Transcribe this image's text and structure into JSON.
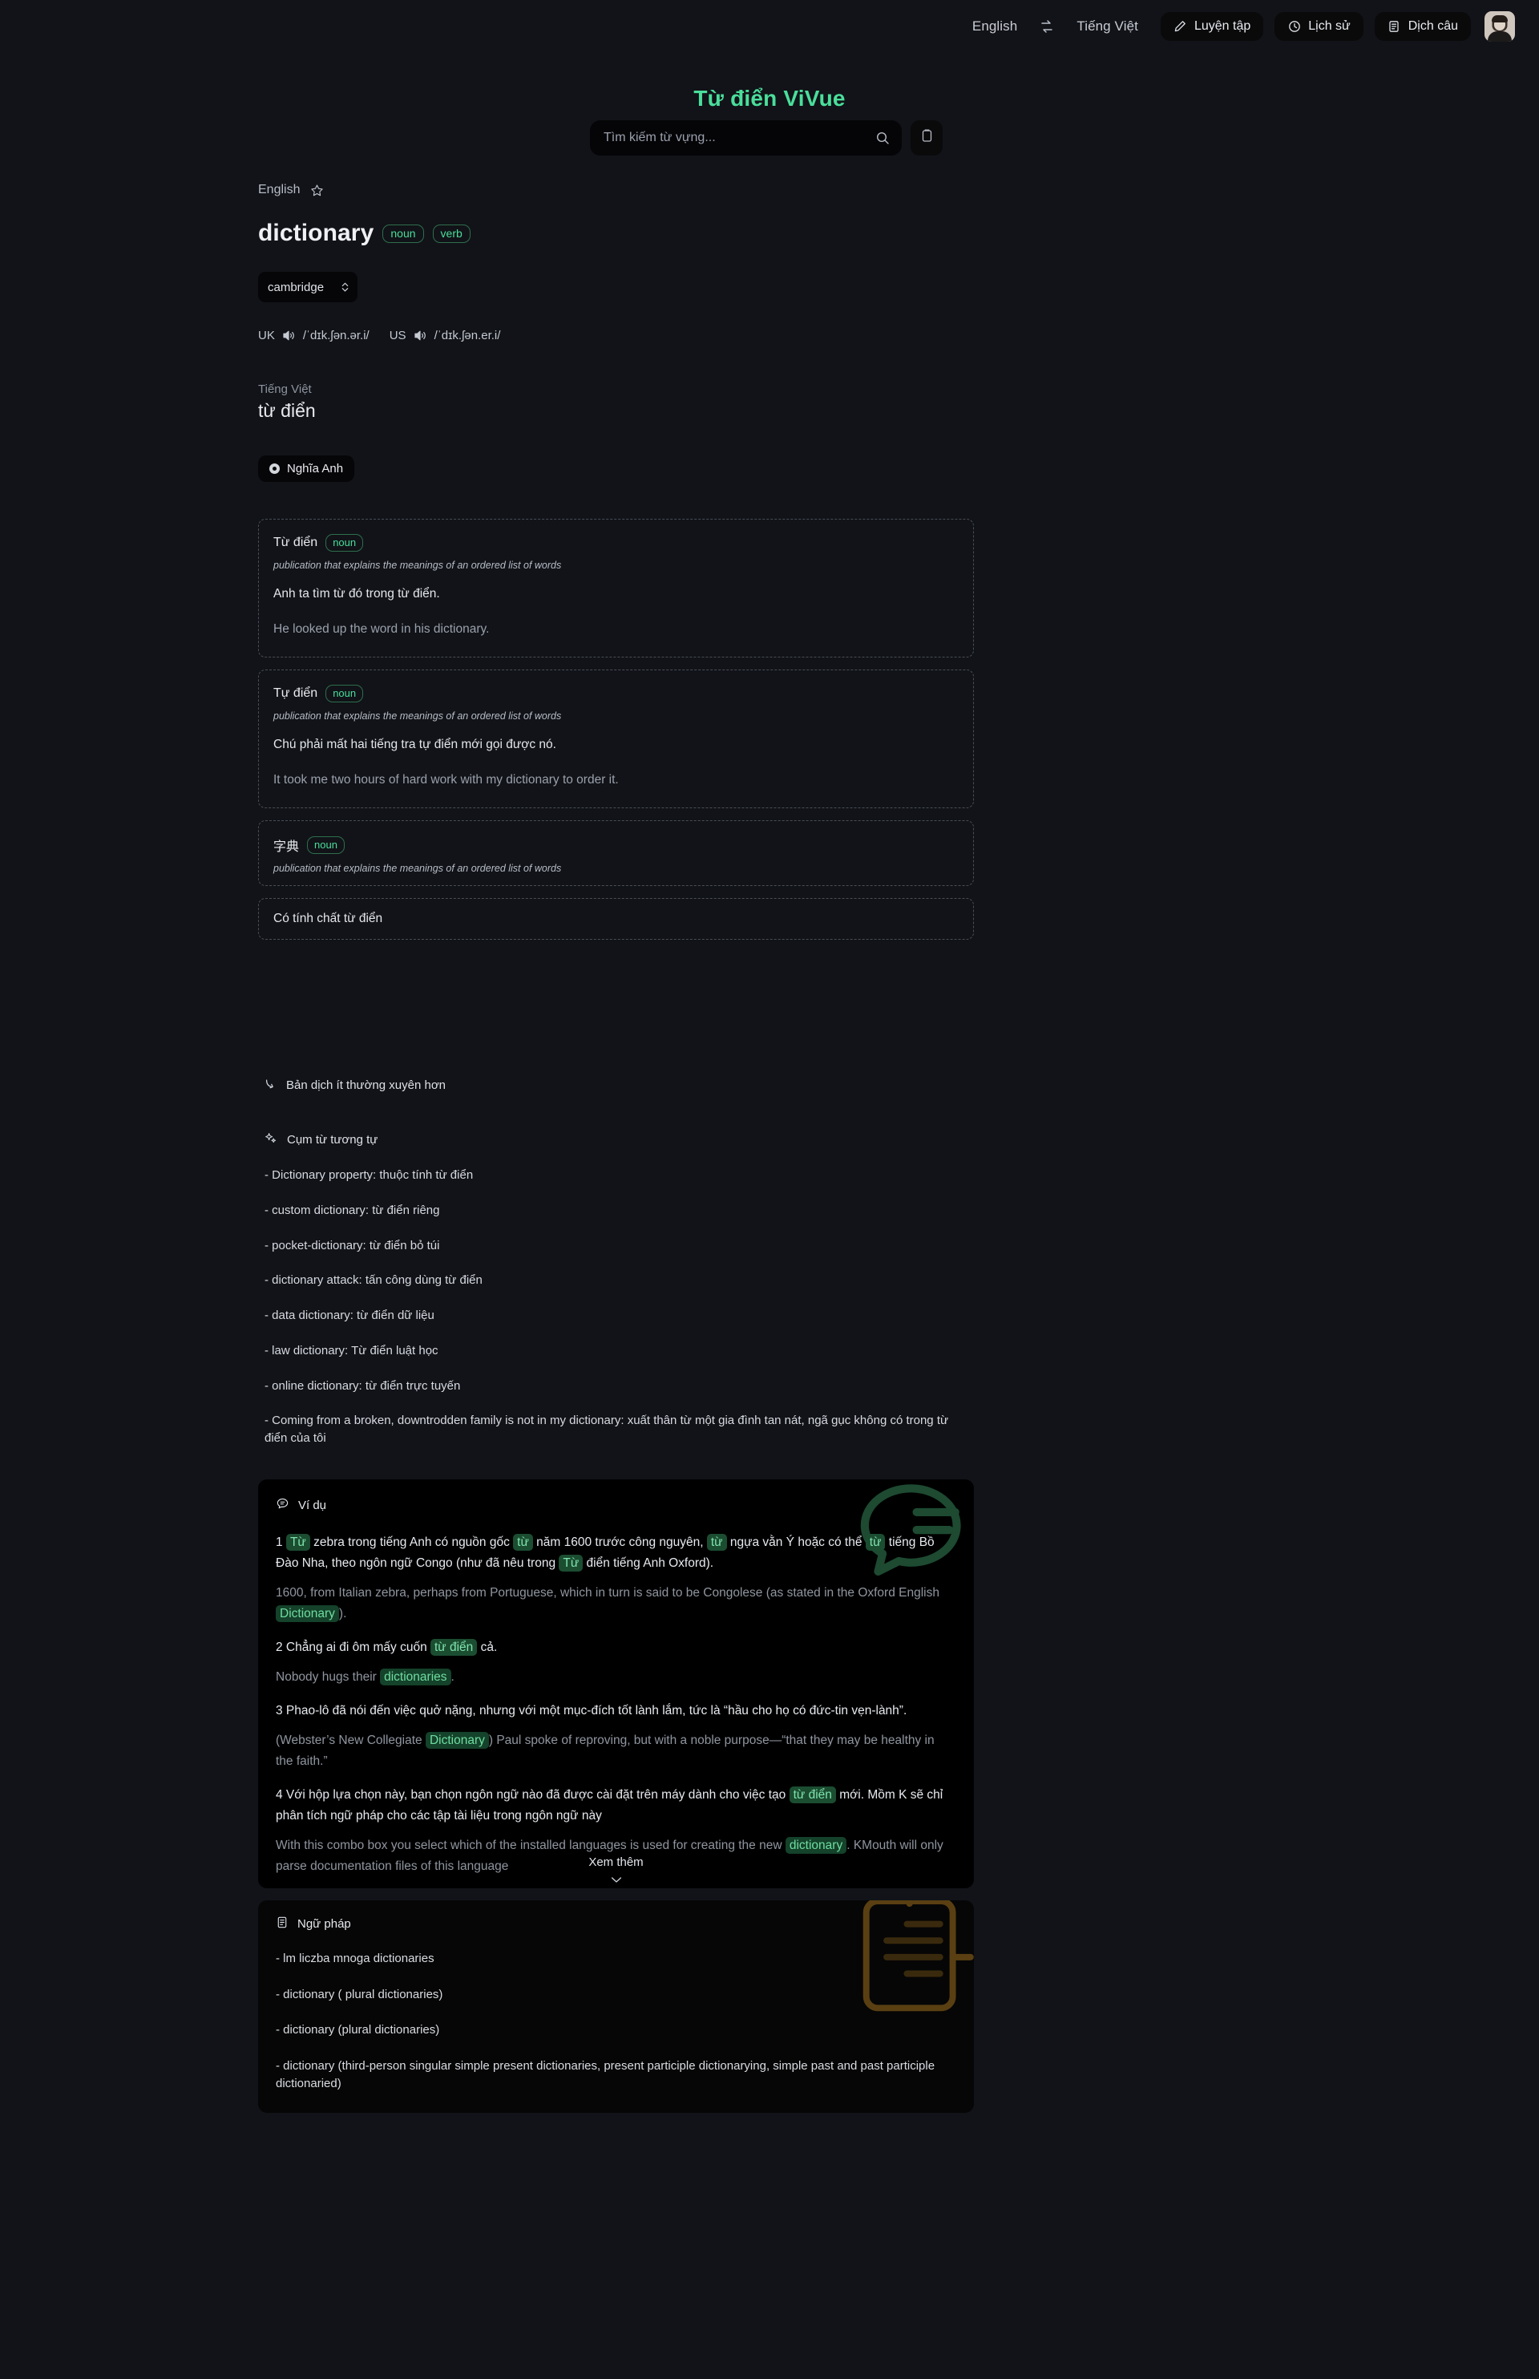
{
  "topbar": {
    "source_language": "English",
    "swap_icon": "swap-arrows-icon",
    "target_language": "Tiếng Việt",
    "buttons": [
      {
        "label": "Luyện tập",
        "icon": "pencil-icon"
      },
      {
        "label": "Lịch sử",
        "icon": "clock-icon"
      },
      {
        "label": "Dịch câu",
        "icon": "document-icon"
      }
    ],
    "avatar": "user-avatar"
  },
  "brand": {
    "title": "Từ điển ViVue"
  },
  "search": {
    "placeholder": "Tìm kiếm từ vựng...",
    "value": "",
    "search_icon": "search-icon",
    "clipboard_icon": "clipboard-icon"
  },
  "entry": {
    "source_language": "English",
    "star_icon": "star-outline-icon",
    "headword": "dictionary",
    "pos_tags": [
      "noun",
      "verb"
    ],
    "dictionary_source": "cambridge",
    "dictionary_options": [
      "cambridge"
    ],
    "pronunciations": [
      {
        "region": "UK",
        "speaker_icon": "speaker-icon",
        "ipa": "/ˈdɪk.ʃən.ər.i/"
      },
      {
        "region": "US",
        "speaker_icon": "speaker-icon",
        "ipa": "/ˈdɪk.ʃən.er.i/"
      }
    ],
    "target_language": "Tiếng Việt",
    "target_word": "từ điển",
    "english_meaning_button": "Nghĩa Anh"
  },
  "definitions": [
    {
      "term": "Từ điển",
      "tag": "noun",
      "gloss": "publication that explains the meanings of an ordered list of words",
      "example_vi": "Anh ta tìm từ đó trong từ điển.",
      "example_en": "He looked up the word in his dictionary."
    },
    {
      "term": "Tự điển",
      "tag": "noun",
      "gloss": "publication that explains the meanings of an ordered list of words",
      "example_vi": "Chú phải mất hai tiếng tra tự điển mới gọi được nó.",
      "example_en": "It took me two hours of hard work with my dictionary to order it."
    },
    {
      "term": "字典",
      "tag": "noun",
      "gloss": "publication that explains the meanings of an ordered list of words",
      "example_vi": "",
      "example_en": ""
    }
  ],
  "extra_definition": "Có tính chất từ điển",
  "less_frequent": {
    "label": "Bản dịch ít thường xuyên hơn",
    "icon": "arrow-curve-down-icon"
  },
  "phrases_section": {
    "title": "Cụm từ tương tự",
    "icon": "sparkle-icon",
    "items": [
      "- Dictionary property: thuộc tính từ điển",
      "- custom dictionary: từ điển riêng",
      "- pocket-dictionary: từ điển bỏ túi",
      "- dictionary attack: tấn công dùng từ điển",
      "- data dictionary: từ điển dữ liệu",
      "- law dictionary: Từ điển luật học",
      "- online dictionary: từ điển trực tuyến",
      "- Coming from a broken, downtrodden family is not in my dictionary: xuất thân từ một gia đình tan nát, ngã gục không có trong từ điển của tôi"
    ]
  },
  "examples_section": {
    "title": "Ví dụ",
    "icon": "quote-bubble-icon",
    "background_icon": "quote-bubble-watermark",
    "items": [
      {
        "number": "1",
        "vi_parts": [
          {
            "t": "1 ",
            "h": false
          },
          {
            "t": "Từ",
            "h": true
          },
          {
            "t": " zebra trong tiếng Anh có nguồn gốc ",
            "h": false
          },
          {
            "t": "từ",
            "h": true
          },
          {
            "t": " năm 1600 trước công nguyên, ",
            "h": false
          },
          {
            "t": "từ",
            "h": true
          },
          {
            "t": " ngựa vằn Ý hoặc có thể ",
            "h": false
          },
          {
            "t": "từ",
            "h": true
          },
          {
            "t": " tiếng Bồ Đào Nha, theo ngôn ngữ Congo (như đã nêu trong ",
            "h": false
          },
          {
            "t": "Từ",
            "h": true
          },
          {
            "t": " điển tiếng Anh Oxford).",
            "h": false
          }
        ],
        "en_parts": [
          {
            "t": "1600, from Italian zebra, perhaps from Portuguese, which in turn is said to be Congolese (as stated in the Oxford English ",
            "h": false
          },
          {
            "t": "Dictionary",
            "h": true
          },
          {
            "t": ").",
            "h": false
          }
        ]
      },
      {
        "number": "2",
        "vi_parts": [
          {
            "t": "2 Chẳng ai đi ôm mấy cuốn ",
            "h": false
          },
          {
            "t": "từ điển",
            "h": true
          },
          {
            "t": " cả.",
            "h": false
          }
        ],
        "en_parts": [
          {
            "t": "Nobody hugs their ",
            "h": false
          },
          {
            "t": "dictionaries",
            "h": true
          },
          {
            "t": ".",
            "h": false
          }
        ]
      },
      {
        "number": "3",
        "vi_parts": [
          {
            "t": "3 Phao-lô đã nói đến việc quở nặng, nhưng với một mục-đích tốt lành lắm, tức là “hầu cho họ có đức-tin vẹn-lành”.",
            "h": false
          }
        ],
        "en_parts": [
          {
            "t": "(Webster’s New Collegiate ",
            "h": false
          },
          {
            "t": "Dictionary",
            "h": true
          },
          {
            "t": ") Paul spoke of reproving, but with a noble purpose—“that they may be healthy in the faith.”",
            "h": false
          }
        ]
      },
      {
        "number": "4",
        "vi_parts": [
          {
            "t": "4 Với hộp lựa chọn này, bạn chọn ngôn ngữ nào đã được cài đặt trên máy dành cho việc tạo ",
            "h": false
          },
          {
            "t": "từ điển",
            "h": true
          },
          {
            "t": " mới. Mồm K sẽ chỉ phân tích ngữ pháp cho các tập tài liệu trong ngôn ngữ này",
            "h": false
          }
        ],
        "en_parts": [
          {
            "t": "With this combo box you select which of the installed languages is used for creating the new ",
            "h": false
          },
          {
            "t": "dictionary",
            "h": true
          },
          {
            "t": ". KMouth will only parse documentation files of this language",
            "h": false
          }
        ]
      }
    ],
    "see_more": "Xem thêm",
    "see_more_icon": "chevron-down-icon"
  },
  "grammar_section": {
    "title": "Ngữ pháp",
    "icon": "document-list-icon",
    "background_icon": "document-list-watermark",
    "items": [
      "- lm  liczba mnoga dictionaries",
      "- dictionary ( plural  dictionaries)",
      "- dictionary (plural dictionaries)",
      "- dictionary (third-person singular simple present dictionaries, present participle dictionarying, simple past and past participle dictionaried)"
    ]
  },
  "colors": {
    "page_bg": "#111318",
    "accent_green": "#4ade9b",
    "card_black": "#000000",
    "highlight_vi": "#1b4d31",
    "grammar_watermark": "#5a3f12"
  }
}
